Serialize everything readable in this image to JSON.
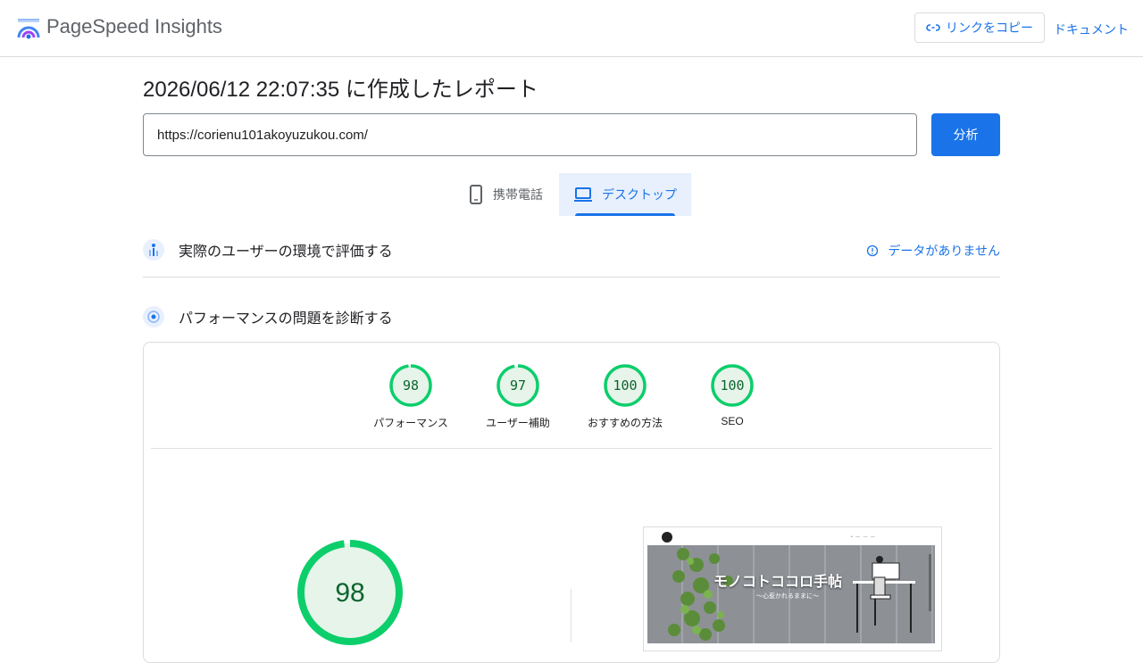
{
  "header": {
    "brand": "PageSpeed Insights",
    "copy_link_label": "リンクをコピー",
    "docs_label": "ドキュメント"
  },
  "report": {
    "title": "2026/06/12 22:07:35 に作成したレポート",
    "url": "https://corienu101akoyuzukou.com/",
    "analyze_label": "分析"
  },
  "tabs": [
    {
      "label": "携帯電話",
      "icon": "phone-icon",
      "selected": false
    },
    {
      "label": "デスクトップ",
      "icon": "laptop-icon",
      "selected": true
    }
  ],
  "field_data": {
    "title": "実際のユーザーの環境で評価する",
    "no_data_label": "データがありません"
  },
  "diagnostics": {
    "title": "パフォーマンスの問題を診断する",
    "scores": [
      {
        "label": "パフォーマンス",
        "value": 98
      },
      {
        "label": "ユーザー補助",
        "value": 97
      },
      {
        "label": "おすすめの方法",
        "value": 100
      },
      {
        "label": "SEO",
        "value": 100
      }
    ],
    "main_score": 98,
    "score_color": "#0cce6b",
    "score_text_color": "#0d652d"
  },
  "screenshot": {
    "site_title": "モノコトココロ手帖",
    "site_subtitle": "〜心惹かれるままに〜"
  }
}
